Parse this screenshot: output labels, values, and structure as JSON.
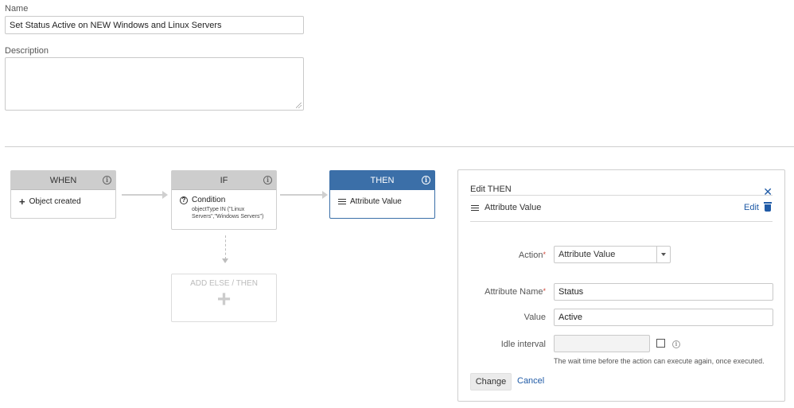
{
  "form": {
    "name_label": "Name",
    "name_value": "Set Status Active on NEW Windows and Linux Servers",
    "description_label": "Description",
    "description_value": ""
  },
  "flow": {
    "when": {
      "header": "WHEN",
      "item": "Object created",
      "icon": "plus-icon"
    },
    "if": {
      "header": "IF",
      "item": "Condition",
      "expression": "objectType IN (\"Linux Servers\",\"Windows Servers\")",
      "icon": "question-circle-icon"
    },
    "then": {
      "header": "THEN",
      "item": "Attribute Value",
      "icon": "list-icon"
    },
    "add": {
      "label": "ADD ELSE / THEN",
      "icon": "plus-icon"
    }
  },
  "panel": {
    "title": "Edit THEN",
    "close_icon": "close-icon",
    "item_label": "Attribute Value",
    "edit_label": "Edit",
    "action_label": "Action",
    "action_value": "Attribute Value",
    "attribute_name_label": "Attribute Name",
    "attribute_name_value": "Status",
    "value_label": "Value",
    "value_value": "Active",
    "idle_label": "Idle interval",
    "idle_value": "",
    "idle_hint": "The wait time before the action can execute again, once executed.",
    "change_label": "Change",
    "cancel_label": "Cancel"
  },
  "colors": {
    "accent": "#3b6fa8",
    "link": "#1f5aa6",
    "required": "#d04437"
  }
}
